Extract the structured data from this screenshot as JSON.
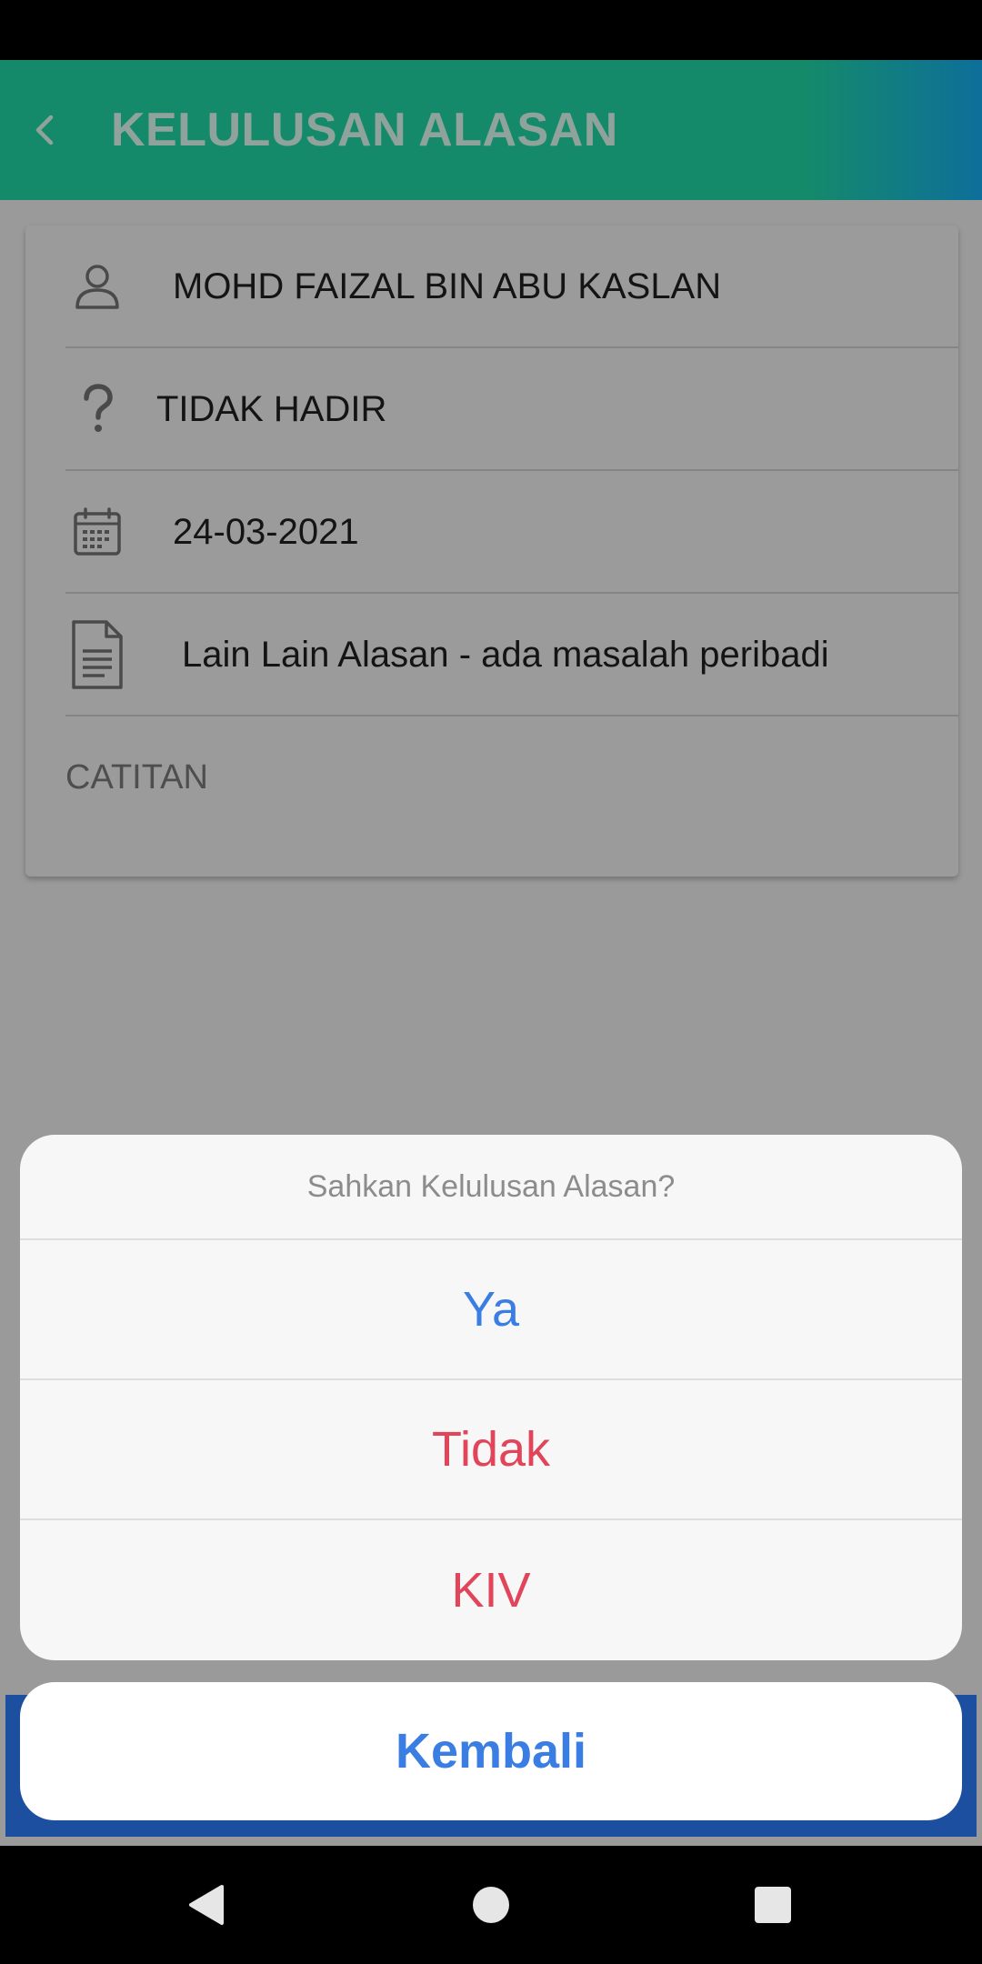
{
  "app_bar": {
    "title": "KELULUSAN ALASAN",
    "back_icon": "chevron-left-icon"
  },
  "details": {
    "name": "MOHD FAIZAL BIN ABU KASLAN",
    "status": "TIDAK HADIR",
    "date": "24-03-2021",
    "reason": "Lain Lain Alasan - ada masalah peribadi",
    "notes_label": "CATITAN",
    "icons": [
      "person-icon",
      "question-icon",
      "calendar-icon",
      "document-icon"
    ]
  },
  "action_sheet": {
    "prompt": "Sahkan Kelulusan Alasan?",
    "options": [
      "Ya",
      "Tidak",
      "KIV"
    ],
    "cancel": "Kembali"
  },
  "colors": {
    "app_bar": "#158a6a",
    "confirm_blue": "#3a7ee3",
    "destructive_red": "#e0455a"
  },
  "nav": [
    "back-triangle-icon",
    "home-circle-icon",
    "recents-square-icon"
  ]
}
